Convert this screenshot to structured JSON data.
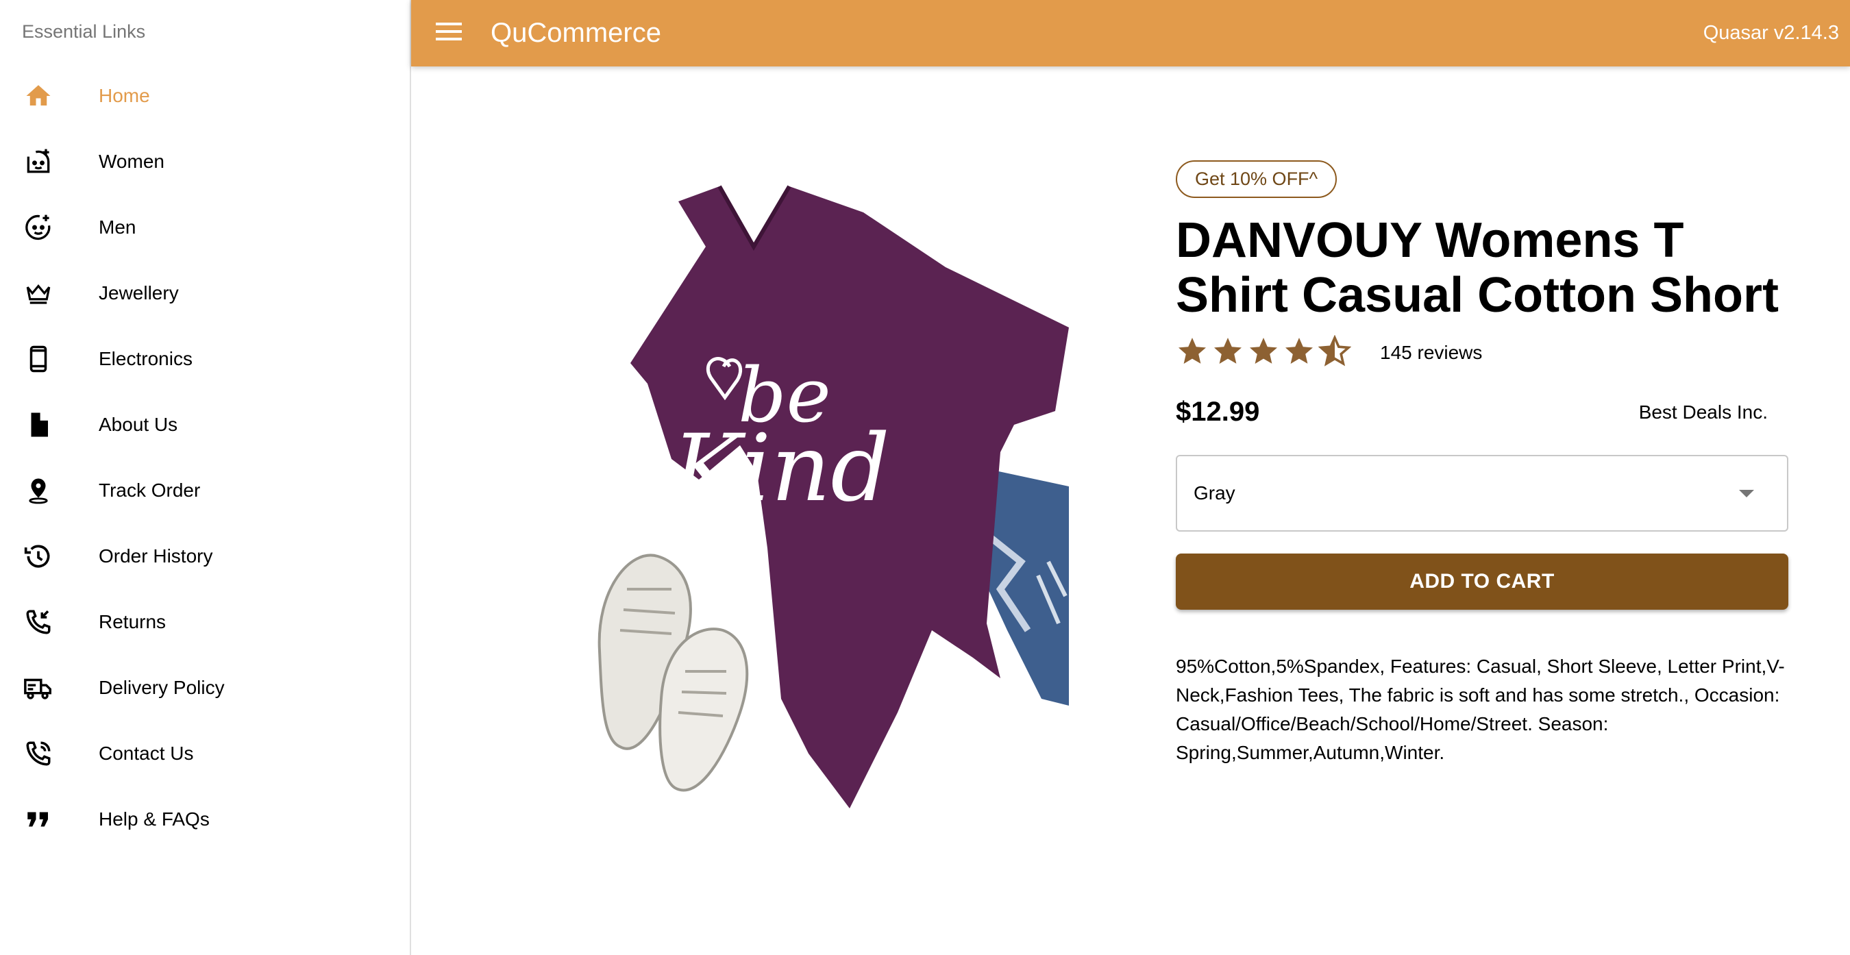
{
  "header": {
    "app_title": "QuCommerce",
    "version": "Quasar v2.14.3"
  },
  "sidebar": {
    "header": "Essential Links",
    "items": [
      {
        "label": "Home",
        "icon": "home-icon",
        "active": true
      },
      {
        "label": "Women",
        "icon": "face-woman-icon"
      },
      {
        "label": "Men",
        "icon": "face-man-icon"
      },
      {
        "label": "Jewellery",
        "icon": "crown-icon"
      },
      {
        "label": "Electronics",
        "icon": "phone-icon"
      },
      {
        "label": "About Us",
        "icon": "document-icon"
      },
      {
        "label": "Track Order",
        "icon": "location-pin-icon"
      },
      {
        "label": "Order History",
        "icon": "history-icon"
      },
      {
        "label": "Returns",
        "icon": "phone-callback-icon"
      },
      {
        "label": "Delivery Policy",
        "icon": "delivery-truck-icon"
      },
      {
        "label": "Contact Us",
        "icon": "phone-in-talk-icon"
      },
      {
        "label": "Help & FAQs",
        "icon": "quote-icon"
      }
    ]
  },
  "product": {
    "promo": "Get 10% OFF^",
    "title": "DANVOUY Womens T Shirt Casual Cotton Short",
    "rating": 4.5,
    "rating_max": 5,
    "reviews": "145 reviews",
    "price": "$12.99",
    "seller": "Best Deals Inc.",
    "selected_color": "Gray",
    "add_to_cart": "ADD TO CART",
    "description": "95%Cotton,5%Spandex, Features: Casual, Short Sleeve, Letter Print,V-Neck,Fashion Tees, The fabric is soft and has some stretch., Occasion: Casual/Office/Beach/School/Home/Street. Season: Spring,Summer,Autumn,Winter.",
    "image_text_line1": "be",
    "image_text_line2": "Kind"
  },
  "colors": {
    "header_bg": "#e29b4b",
    "active_nav": "#e29b4b",
    "button_bg": "#80521a",
    "star": "#8d6132",
    "shirt": "#5b2352",
    "jeans": "#3e5f8e"
  }
}
